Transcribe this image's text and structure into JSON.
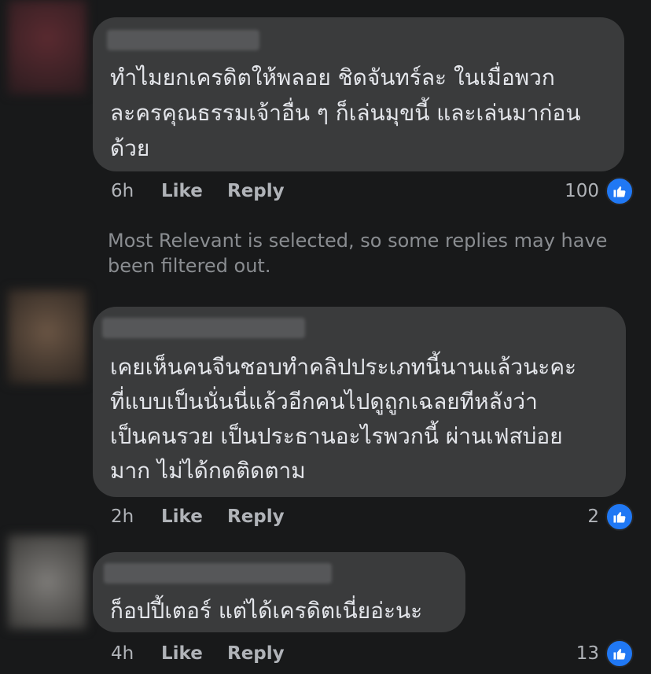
{
  "comments": [
    {
      "lines": [
        "ทำไมยกเครดิตให้พลอย ชิดจันทร์ละ ในเมื่อพวก",
        "ละครคุณธรรมเจ้าอื่น ๆ ก็เล่นมุขนี้ และเล่นมาก่อน",
        "ด้วย"
      ],
      "time": "6h",
      "like_label": "Like",
      "reply_label": "Reply",
      "reaction_count": "100",
      "reaction_icon": "thumbs-up-icon"
    },
    {
      "lines": [
        "เคยเห็นคนจีนชอบทำคลิปประเภทนี้นานแล้วนะคะ",
        "ที่แบบเป็นนั่นนี่แล้วอีกคนไปดูถูกเฉลยทีหลังว่า",
        "เป็นคนรวย เป็นประธานอะไรพวกนี้ ผ่านเฟสบ่อย",
        "มาก ไม่ได้กดติดตาม"
      ],
      "time": "2h",
      "like_label": "Like",
      "reply_label": "Reply",
      "reaction_count": "2",
      "reaction_icon": "thumbs-up-icon"
    },
    {
      "lines": [
        "ก็อปปี้เตอร์ แต่ได้เครดิตเนี่ยอ่ะนะ"
      ],
      "time": "4h",
      "like_label": "Like",
      "reply_label": "Reply",
      "reaction_count": "13",
      "reaction_icon": "thumbs-up-icon"
    }
  ],
  "filter_notice": "Most Relevant is selected, so some replies may have been filtered out.",
  "colors": {
    "background": "#18191a",
    "bubble": "#3a3b3c",
    "text": "#e4e6eb",
    "secondary_text": "#b0b3b8",
    "like_blue": "#2078f4"
  }
}
